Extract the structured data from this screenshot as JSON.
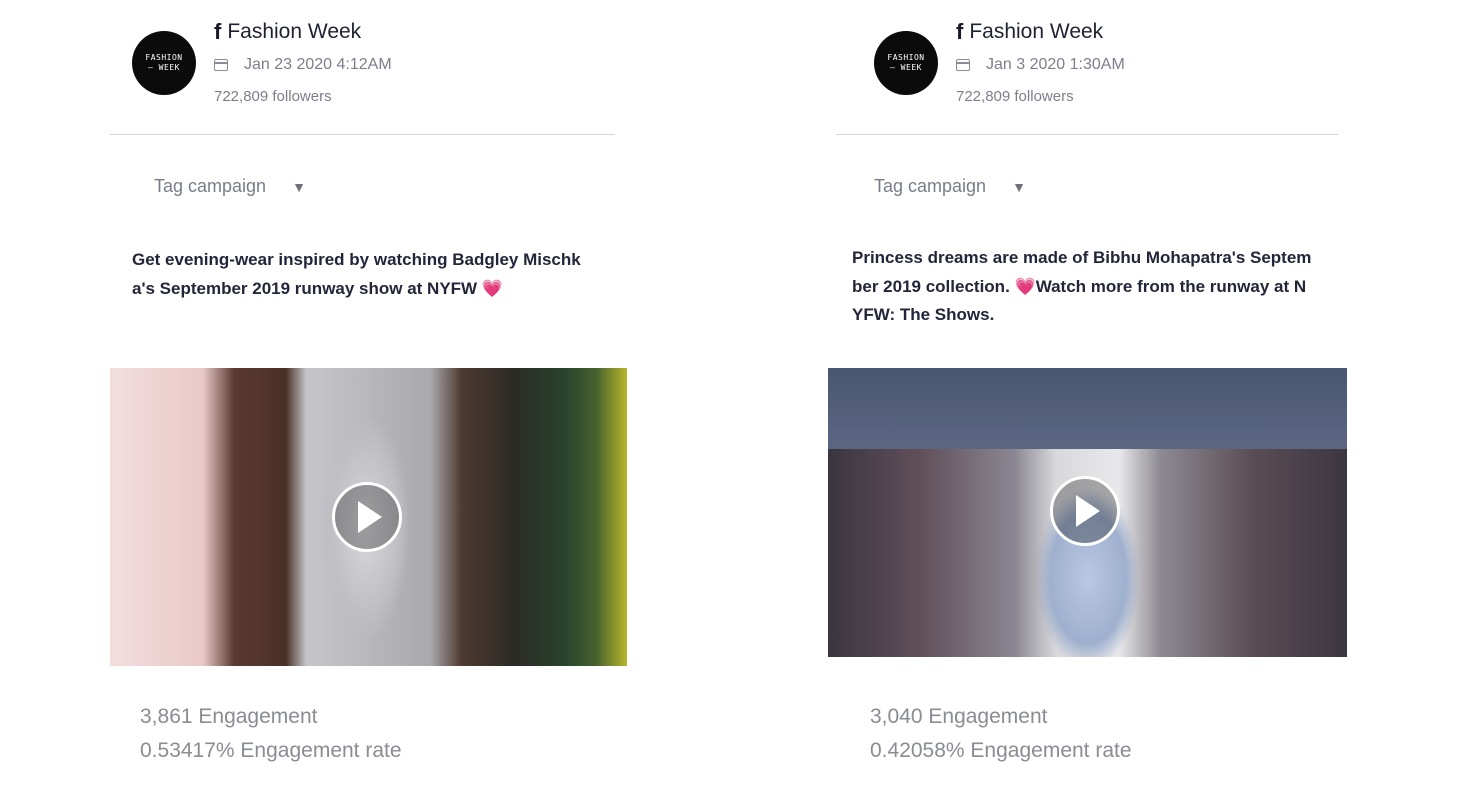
{
  "posts": [
    {
      "page_name": "Fashion Week",
      "avatar": {
        "line1": "FASHION",
        "line2": "— WEEK"
      },
      "platform_icon": "facebook-icon",
      "date": "Jan 23 2020 4:12AM",
      "followers": "722,809 followers",
      "tag_campaign": "Tag campaign",
      "caption": "Get evening-wear inspired by watching Badgley Mischka's September 2019 runway show at NYFW",
      "caption_emoji": "💗",
      "media_icon": "play-icon",
      "engagement": "3,861 Engagement",
      "engagement_rate": "0.53417% Engagement rate"
    },
    {
      "page_name": "Fashion Week",
      "avatar": {
        "line1": "FASHION",
        "line2": "— WEEK"
      },
      "platform_icon": "facebook-icon",
      "date": "Jan 3 2020 1:30AM",
      "followers": "722,809 followers",
      "tag_campaign": "Tag campaign",
      "caption_part1": "Princess dreams are made of Bibhu Mohapatra's September 2019 collection. ",
      "caption_emoji": "💗",
      "caption_part2": "Watch more from the runway at NYFW: The Shows.",
      "media_icon": "play-icon",
      "engagement": "3,040 Engagement",
      "engagement_rate": "0.42058% Engagement rate"
    }
  ],
  "symbols": {
    "facebook": "f",
    "caret": "▼"
  }
}
